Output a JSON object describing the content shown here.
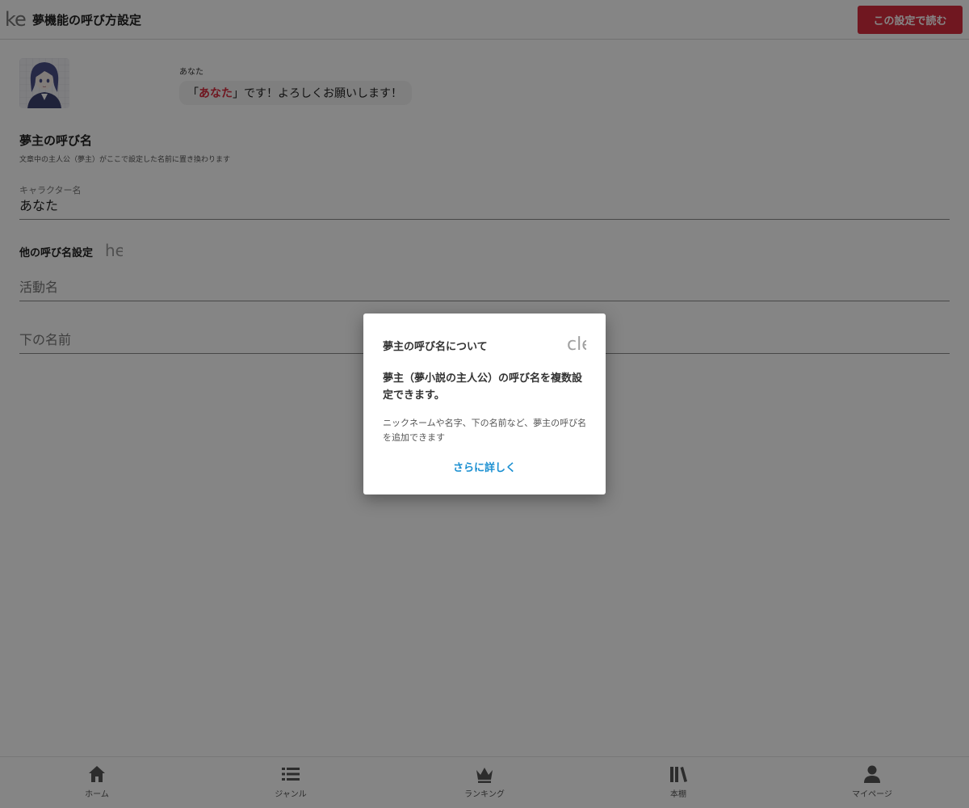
{
  "header": {
    "back_icon_text": "ke",
    "title": "夢機能の呼び方設定",
    "read_button_label": "この設定で読む"
  },
  "preview": {
    "speaker_name": "あなた",
    "bubble_prefix": "「",
    "bubble_highlight": "あなた",
    "bubble_suffix": "」です！よろしくお願いします！"
  },
  "main_name": {
    "title": "夢主の呼び名",
    "description": "文章中の主人公（夢主）がここで設定した名前に置き換わります",
    "field_label": "キャラクター名",
    "field_value": "あなた"
  },
  "other_names": {
    "title": "他の呼び名設定",
    "help_icon_text": "he",
    "fields": [
      {
        "placeholder": "活動名"
      },
      {
        "placeholder": "下の名前"
      }
    ]
  },
  "bottom_nav": [
    {
      "label": "ホーム",
      "icon": "home-icon"
    },
    {
      "label": "ジャンル",
      "icon": "list-icon"
    },
    {
      "label": "ランキング",
      "icon": "crown-icon"
    },
    {
      "label": "本棚",
      "icon": "bookshelf-icon"
    },
    {
      "label": "マイページ",
      "icon": "person-icon"
    }
  ],
  "modal": {
    "title": "夢主の呼び名について",
    "close_icon_text": "cle",
    "heading": "夢主（夢小説の主人公）の呼び名を複数設定できます。",
    "body": "ニックネームや名字、下の名前など、夢主の呼び名を追加できます",
    "more_link": "さらに詳しく"
  },
  "colors": {
    "accent_red": "#d62c3f",
    "link_blue": "#1a8fd1",
    "overlay": "rgba(0,0,0,0.48)"
  }
}
